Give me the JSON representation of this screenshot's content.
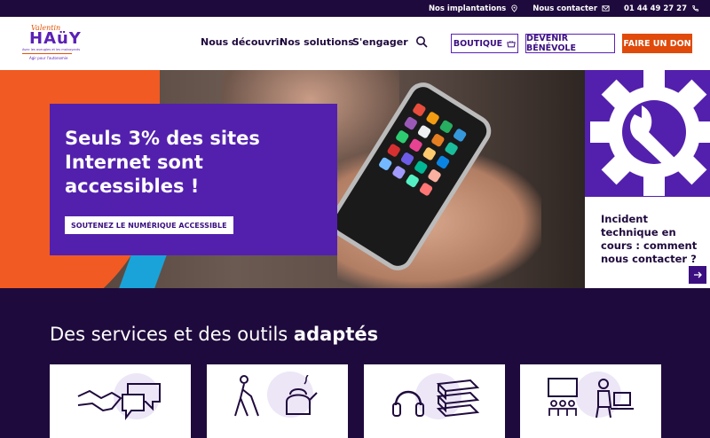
{
  "topbar": {
    "locations": "Nos implantations",
    "contact": "Nous contacter",
    "phone": "01 44 49 27 27"
  },
  "logo": {
    "line1": "Valentin",
    "line2": "HAüY",
    "tagline": "Avec les aveugles et les malvoyants",
    "subtitle": "Agir pour l'autonomie"
  },
  "nav": {
    "discover": "Nous découvrir",
    "solutions": "Nos solutions",
    "engage": "S'engager"
  },
  "buttons": {
    "shop": "BOUTIQUE",
    "volunteer": "DEVENIR BÉNÉVOLE",
    "donate": "FAIRE UN DON"
  },
  "hero": {
    "title": "Seuls 3% des sites Internet sont accessibles !",
    "cta": "SOUTENEZ LE NUMÉRIQUE ACCESSIBLE"
  },
  "side": {
    "text": "Incident technique en cours : comment nous contacter ?"
  },
  "services": {
    "title_regular": "Des services et des outils ",
    "title_bold": "adaptés"
  },
  "colors": {
    "brand_purple": "#5320ad",
    "dark_navy": "#1f0a3d",
    "donate_orange": "#e04a0a"
  }
}
